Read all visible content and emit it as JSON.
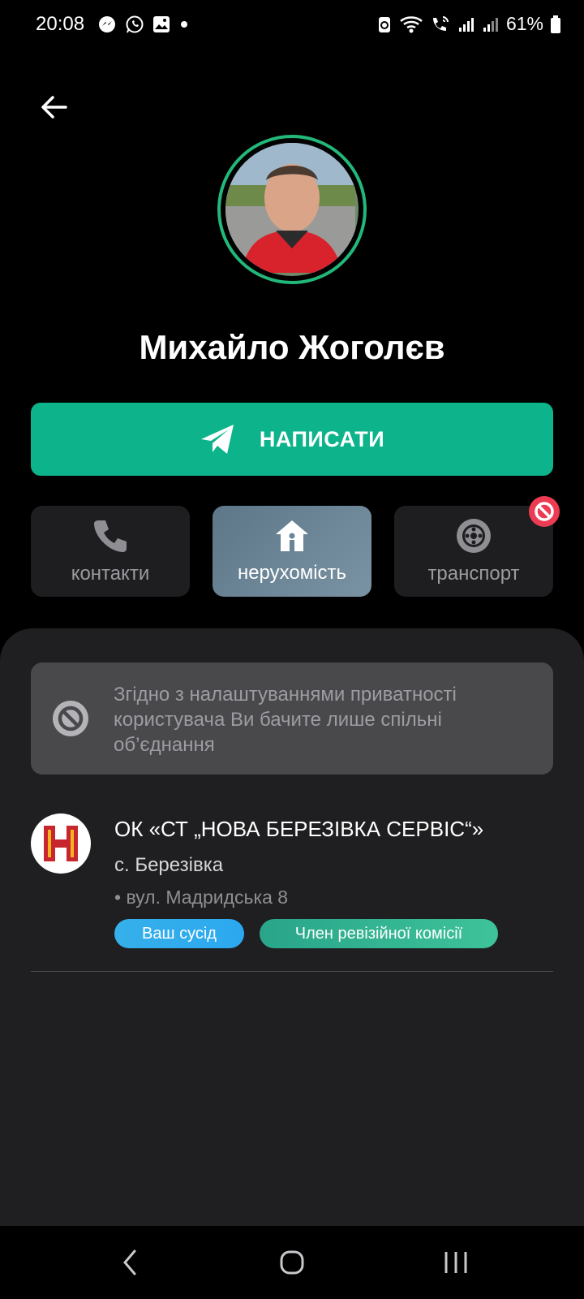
{
  "status_bar": {
    "time": "20:08",
    "battery_percent": "61%",
    "left_icons": [
      "messenger-icon",
      "whatsapp-icon",
      "gallery-icon",
      "dot-icon"
    ],
    "right_icons": [
      "recycle-icon",
      "wifi-icon",
      "wifi-call-icon",
      "signal-icon",
      "signal-icon",
      "battery-icon"
    ]
  },
  "profile": {
    "name": "Михайло Жоголєв",
    "avatar_ring_color": "#22b87a"
  },
  "actions": {
    "write_label": "НАПИСАТИ",
    "accent": "#0db38a"
  },
  "tabs": [
    {
      "label": "контакти",
      "icon": "phone-icon",
      "active": false
    },
    {
      "label": "нерухомість",
      "icon": "home-icon",
      "active": true
    },
    {
      "label": "транспорт",
      "icon": "wheel-icon",
      "active": false,
      "blocked": true
    }
  ],
  "privacy_notice": {
    "text": "Згідно з налаштуваннями приватності користувача Ви бачите лише спільні об’єднання"
  },
  "organizations": [
    {
      "name": "ОК «СТ „НОВА БЕРЕЗІВКА СЕРВІС“»",
      "village": "с. Березівка",
      "street": "• вул. Мадридська 8",
      "tags": [
        "Ваш сусід",
        "Член ревізійної комісії"
      ]
    }
  ]
}
